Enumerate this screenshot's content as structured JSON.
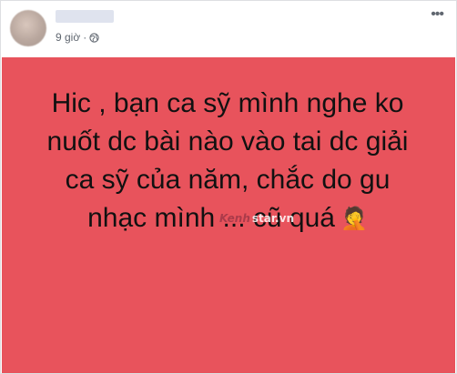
{
  "post": {
    "time_label": "9 giờ",
    "privacy_icon": "globe-icon",
    "more_icon": "more-icon",
    "background_color": "#e8535c",
    "text_lines": [
      "Hic , bạn ca sỹ mình nghe ko",
      "nuốt dc bài nào vào tai dc giải",
      "ca sỹ của năm, chắc do gu",
      "nhạc mình ... cũ quá"
    ],
    "emoji": "🤦",
    "watermark": {
      "brand": "Kenh",
      "site": "star.vn"
    }
  }
}
